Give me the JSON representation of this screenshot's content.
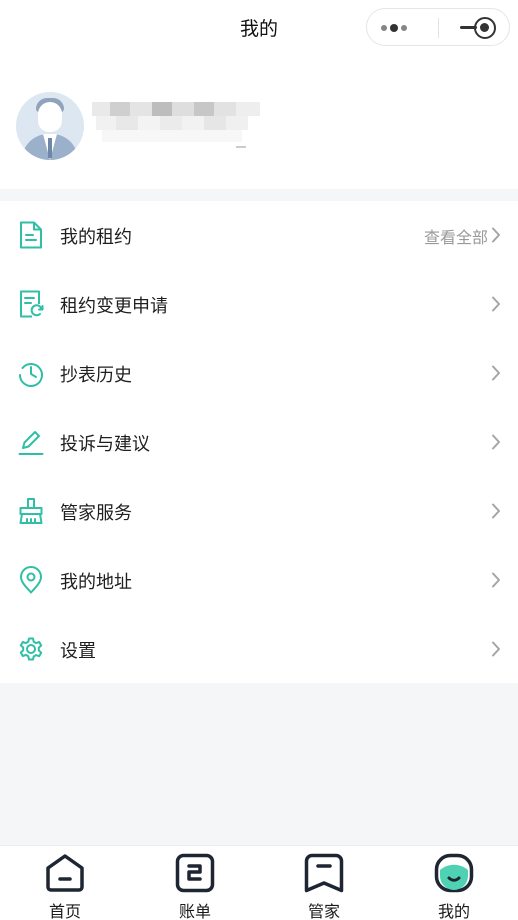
{
  "header": {
    "title": "我的"
  },
  "capsule": {
    "more_icon": "more-dots-icon",
    "minimize_icon": "minimize-icon",
    "close_icon": "record-close-icon"
  },
  "profile": {
    "avatar_icon": "user-avatar-icon",
    "name": ""
  },
  "menu": {
    "items": [
      {
        "label": "我的租约",
        "extra": "查看全部",
        "icon": "document-icon"
      },
      {
        "label": "租约变更申请",
        "extra": "",
        "icon": "document-refresh-icon"
      },
      {
        "label": "抄表历史",
        "extra": "",
        "icon": "clock-history-icon"
      },
      {
        "label": "投诉与建议",
        "extra": "",
        "icon": "pen-icon"
      },
      {
        "label": "管家服务",
        "extra": "",
        "icon": "broom-icon"
      },
      {
        "label": "我的地址",
        "extra": "",
        "icon": "location-pin-icon"
      },
      {
        "label": "设置",
        "extra": "",
        "icon": "gear-icon"
      }
    ]
  },
  "tabbar": {
    "items": [
      {
        "label": "首页",
        "icon": "home-icon",
        "active": false
      },
      {
        "label": "账单",
        "icon": "bill-icon",
        "active": false
      },
      {
        "label": "管家",
        "icon": "butler-icon",
        "active": false
      },
      {
        "label": "我的",
        "icon": "profile-smile-icon",
        "active": true
      }
    ]
  },
  "colors": {
    "accent": "#2fbfa5",
    "text": "#1f1f1f",
    "muted": "#9a9a9a",
    "background": "#f5f6f8",
    "tab_icon": "#1e2533"
  }
}
